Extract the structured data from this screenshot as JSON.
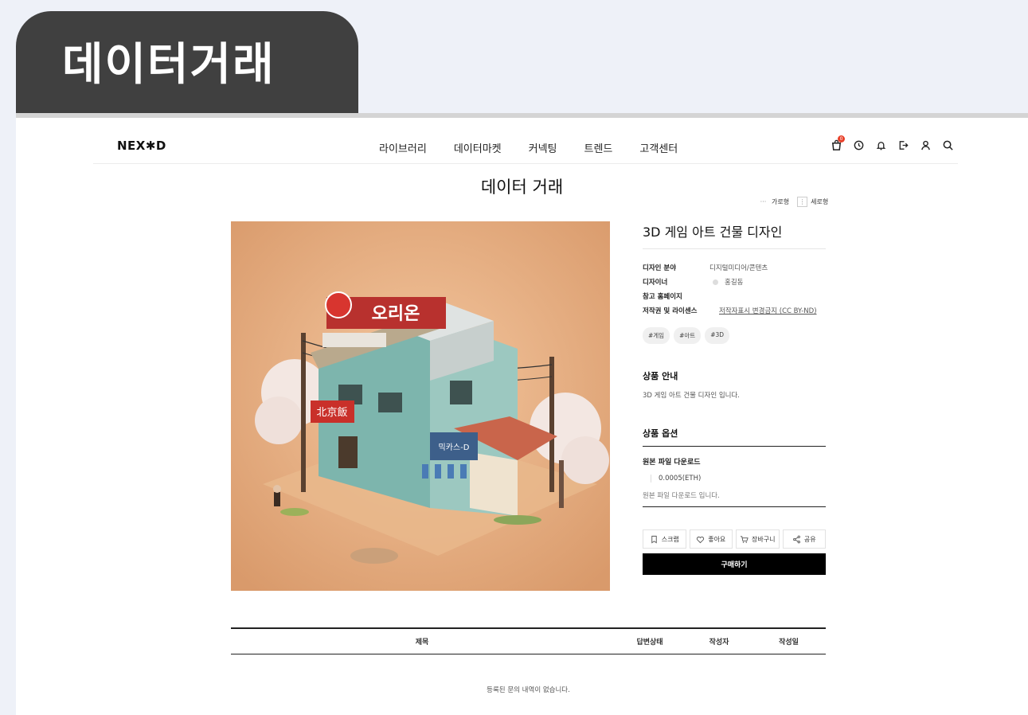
{
  "banner": {
    "title": "데이터거래"
  },
  "header": {
    "logo": "NEX✱D",
    "nav": [
      "라이브러리",
      "데이터마켓",
      "커넥팅",
      "트렌드",
      "고객센터"
    ],
    "cart_badge": "0",
    "icons": [
      "cart-icon",
      "clock-icon",
      "bell-icon",
      "logout-icon",
      "user-icon",
      "search-icon"
    ]
  },
  "page": {
    "title": "데이터 거래"
  },
  "view_toggle": {
    "horizontal": "가로형",
    "vertical": "세로형"
  },
  "product": {
    "title": "3D 게임 아트 건물 디자인",
    "meta": [
      {
        "key": "디자인 분야",
        "value": "디지털미디어/콘텐츠"
      },
      {
        "key": "디자이너",
        "value": "홍길동"
      },
      {
        "key": "참고 홈페이지",
        "value": ""
      },
      {
        "key": "저작권 및 라이센스",
        "value": "저작자표시 변경금지 (CC BY-ND)"
      }
    ],
    "tags": [
      "#게임",
      "#아트",
      "#3D"
    ],
    "guide_heading": "상품 안내",
    "guide_desc": "3D 게임 아트 건물 디자인 입니다.",
    "option_heading": "상품 옵션",
    "option_name": "원본 파일 다운로드",
    "option_price": "0.0005(ETH)",
    "option_desc": "원본 파일 다운로드 입니다.",
    "actions": {
      "scrap": "스크랩",
      "like": "좋아요",
      "cart": "장바구니",
      "share": "공유"
    },
    "buy_label": "구매하기",
    "image_signs": {
      "main_sign": "오리온",
      "side_sign": "北京飯",
      "shop_sign": "믹카스-D"
    }
  },
  "qna": {
    "headers": [
      "제목",
      "답변상태",
      "작성자",
      "작성일"
    ],
    "empty_text": "등록된 문의 내역이 없습니다."
  },
  "colors": {
    "banner_bg": "#404040",
    "page_bg": "#eef1f8",
    "accent": "#e8402a",
    "buy_bg": "#000000"
  }
}
